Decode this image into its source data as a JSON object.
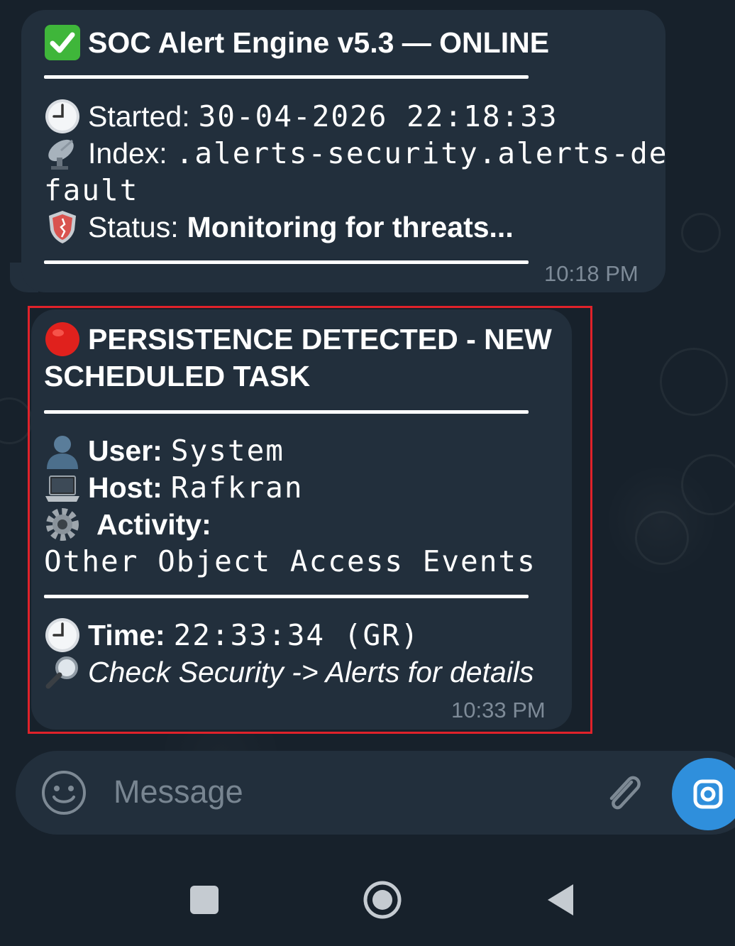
{
  "msg1": {
    "title": "SOC Alert Engine v5.3 — ONLINE",
    "started_label": "Started:",
    "started_value": "30-04-2026 22:18:33",
    "index_label": "Index:",
    "index_value_line1": ".alerts-security.alerts-de",
    "index_value_line2": "fault",
    "status_label": "Status:",
    "status_value": "Monitoring for threats...",
    "time": "10:18 PM"
  },
  "msg2": {
    "title_line1": "PERSISTENCE DETECTED - NEW",
    "title_line2": "SCHEDULED TASK",
    "user_label": "User:",
    "user_value": "System",
    "host_label": "Host:",
    "host_value": "Rafkran",
    "activity_label": "Activity:",
    "activity_value": "Other Object Access Events",
    "time_label": "Time:",
    "time_value": "22:33:34 (GR)",
    "check_text": "Check Security -> Alerts for details",
    "time": "10:33 PM"
  },
  "composer": {
    "placeholder": "Message"
  },
  "icons": {
    "check": "check-mark-icon",
    "clock": "clock-icon",
    "satellite": "satellite-dish-icon",
    "shield": "shield-icon",
    "red_circle": "red-circle-icon",
    "user": "user-silhouette-icon",
    "laptop": "laptop-icon",
    "gear": "gear-icon",
    "magnifier": "magnifying-glass-icon",
    "emoji": "smiley-icon",
    "attach": "paperclip-icon",
    "camera": "camera-icon",
    "nav_recents": "square-icon",
    "nav_home": "home-circle-icon",
    "nav_back": "back-triangle-icon"
  },
  "colors": {
    "background": "#17212b",
    "bubble": "#222f3c",
    "highlight": "#e0222a",
    "timestamp": "#7e8b98",
    "accent": "#2f8fdc"
  }
}
